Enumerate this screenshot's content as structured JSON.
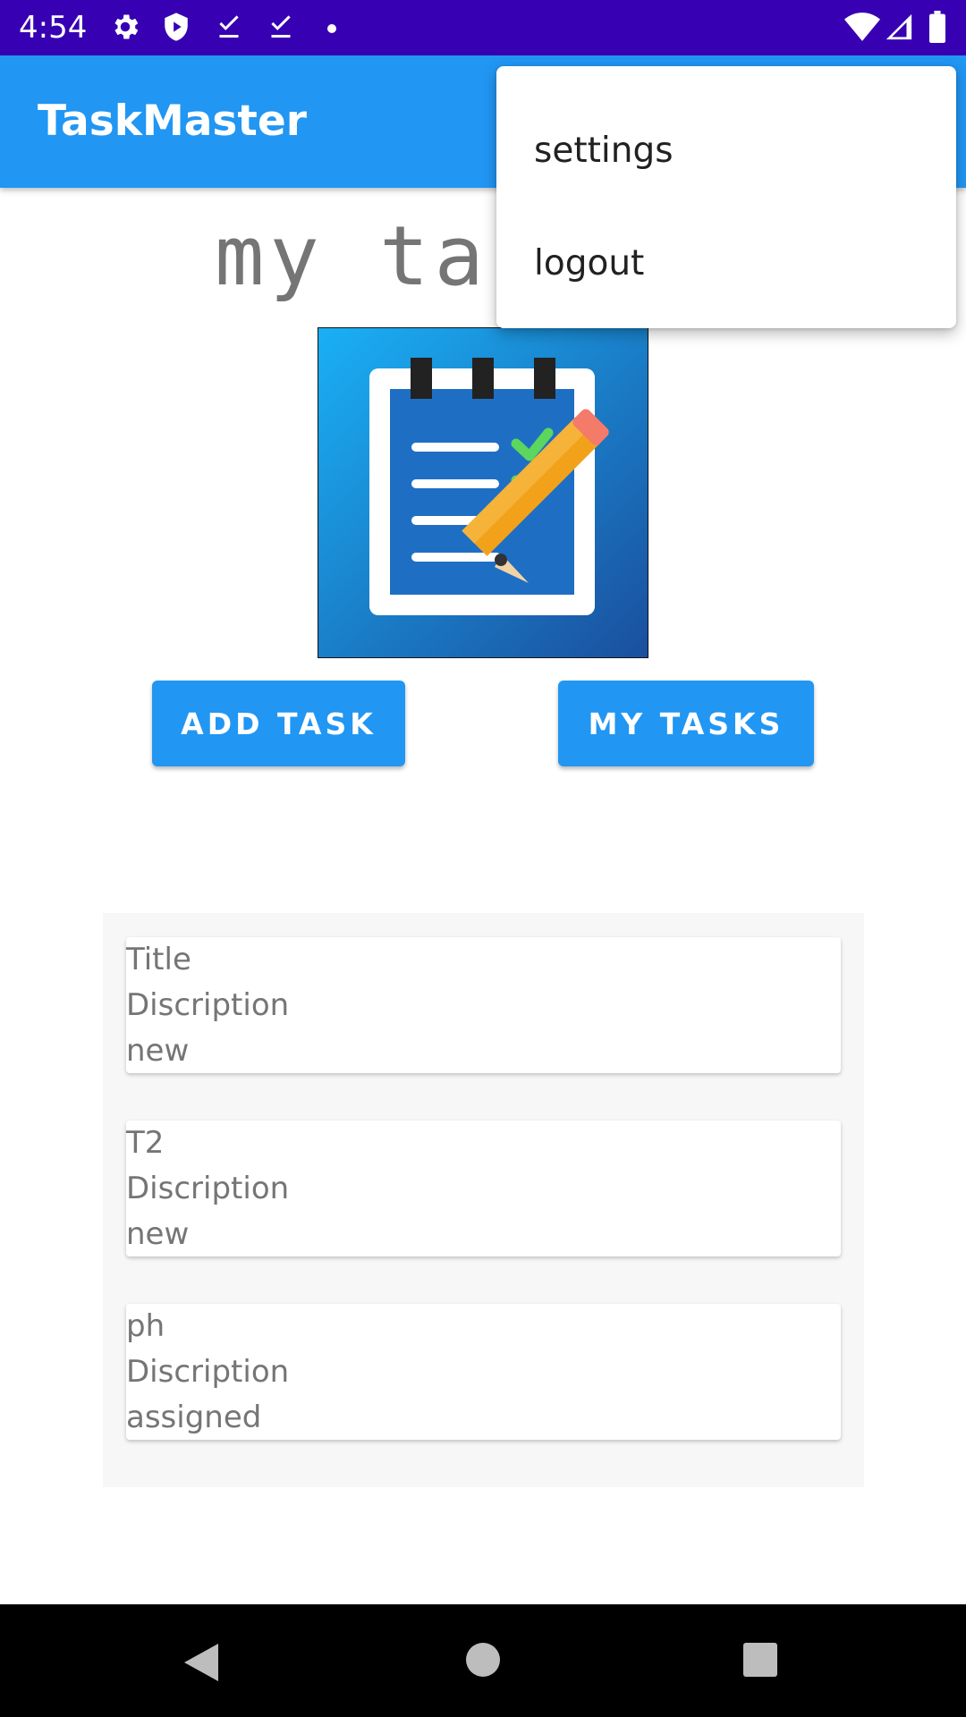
{
  "status_bar": {
    "time": "4:54",
    "left_icons": [
      "gear-icon",
      "shield-icon",
      "download-done-icon",
      "download-done-icon",
      "dot-icon"
    ],
    "right_icons": [
      "wifi-icon",
      "signal-icon",
      "battery-icon"
    ],
    "background": "#3700b3"
  },
  "app_bar": {
    "title": "TaskMaster",
    "background": "#2196f3"
  },
  "main": {
    "heading": "my ta",
    "logo_icon": "notepad-checklist-pencil-icon",
    "add_task_label": "ADD TASK",
    "my_tasks_label": "MY TASKS"
  },
  "tasks": [
    {
      "title": "Title",
      "description": "Discription",
      "status": "new"
    },
    {
      "title": "T2",
      "description": "Discription",
      "status": "new"
    },
    {
      "title": "ph",
      "description": "Discription",
      "status": "assigned"
    }
  ],
  "menu": {
    "items": [
      {
        "label": "settings"
      },
      {
        "label": "logout"
      }
    ]
  },
  "nav_bar": {
    "buttons": [
      "back-icon",
      "home-icon",
      "recents-icon"
    ]
  }
}
